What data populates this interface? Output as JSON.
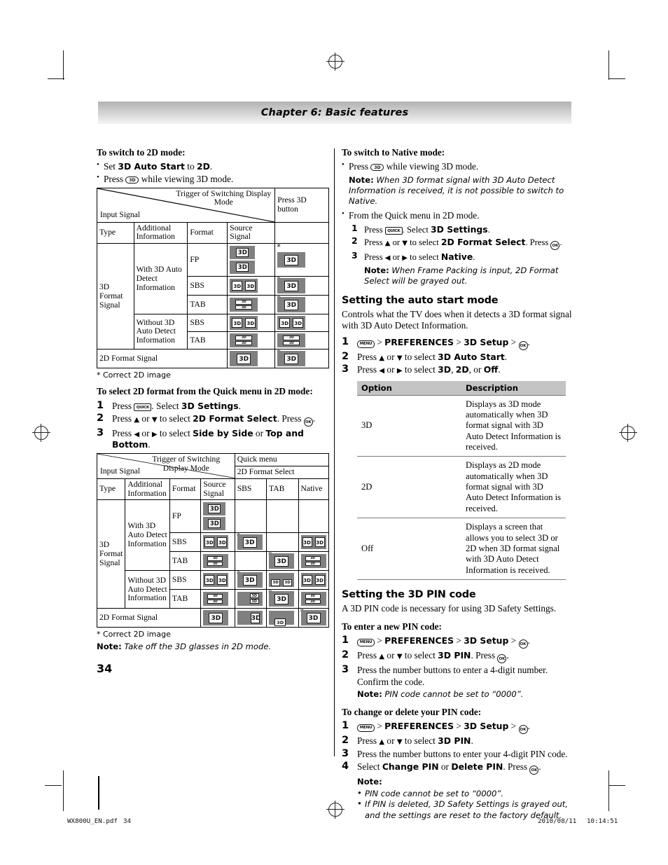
{
  "header": {
    "chapter_title": "Chapter 6: Basic features"
  },
  "left_column": {
    "switch_2d": {
      "heading": "To switch to 2D mode:",
      "bullets": [
        {
          "pre": "Set ",
          "bold1": "3D Auto Start",
          "mid": " to ",
          "bold2": "2D",
          "post": "."
        },
        {
          "pre": "Press ",
          "key": "3D",
          "post": " while viewing 3D mode."
        }
      ]
    },
    "table1": {
      "corner_trigger": "Trigger of Switching Display Mode",
      "corner_input": "Input Signal",
      "col_press3d": "Press 3D button",
      "subheaders": [
        "Type",
        "Additional Information",
        "Format",
        "Source Signal"
      ],
      "rows": [
        {
          "type": "3D Format Signal",
          "info": "With 3D Auto Detect Information",
          "format": "FP",
          "source": "fp",
          "press3d": "full",
          "press3d_star": true
        },
        {
          "type": "",
          "info": "",
          "format": "SBS",
          "source": "sbs",
          "press3d": "full",
          "press3d_star": true
        },
        {
          "type": "",
          "info": "",
          "format": "TAB",
          "source": "tab",
          "press3d": "full",
          "press3d_star": true
        },
        {
          "type": "",
          "info": "Without 3D Auto Detect Information",
          "format": "SBS",
          "source": "sbs",
          "press3d": "sbs",
          "press3d_star": false
        },
        {
          "type": "",
          "info": "",
          "format": "TAB",
          "source": "tab",
          "press3d": "tab",
          "press3d_star": false
        }
      ],
      "last_row_label": "2D Format Signal",
      "last_row_source": "full",
      "last_row_press3d": "full",
      "last_row_star": true,
      "footnote": "* Correct 2D image"
    },
    "select_2d_quick": {
      "heading": "To select 2D format from the Quick menu in 2D mode:",
      "steps": [
        {
          "num": "1",
          "parts": [
            "Press ",
            "KEY:QUICK",
            ". Select ",
            "B:3D Settings",
            "."
          ]
        },
        {
          "num": "2",
          "parts": [
            "Press ",
            "ARROW:up",
            " or ",
            "ARROW:down",
            " to select ",
            "B:2D Format Select",
            ". Press ",
            "KEY:OK",
            "."
          ]
        },
        {
          "num": "3",
          "parts": [
            " Press ",
            "ARROW:left",
            " or ",
            "ARROW:right",
            " to select ",
            "B:Side by Side",
            " or ",
            "B:Top and Bottom",
            "."
          ]
        }
      ]
    },
    "table2": {
      "corner_trigger": "Trigger of Switching Display Mode",
      "corner_input": "Input Signal",
      "col_quickmenu": "Quick menu",
      "col_2dformat": "2D Format Select",
      "subheaders": [
        "Type",
        "Additional Information",
        "Format",
        "Source Signal"
      ],
      "opt_headers": [
        "SBS",
        "TAB",
        "Native"
      ],
      "rows": [
        {
          "type": "3D Format Signal",
          "info": "With 3D Auto Detect Information",
          "format": "FP",
          "source": "fp",
          "sbs": {
            "icon": "gray"
          },
          "tab": {
            "icon": "gray"
          },
          "native": {
            "icon": "gray"
          }
        },
        {
          "type": "",
          "info": "",
          "format": "SBS",
          "source": "sbs",
          "sbs": {
            "icon": "full",
            "star": true
          },
          "tab": {
            "icon": "gray"
          },
          "native": {
            "icon": "sbs"
          }
        },
        {
          "type": "",
          "info": "",
          "format": "TAB",
          "source": "tab",
          "sbs": {
            "icon": "gray"
          },
          "tab": {
            "icon": "full",
            "star": true
          },
          "native": {
            "icon": "tab"
          }
        },
        {
          "type": "",
          "info": "Without 3D Auto Detect Information",
          "format": "SBS",
          "source": "sbs",
          "sbs": {
            "icon": "full",
            "star": true
          },
          "tab": {
            "icon": "sbs-sq"
          },
          "native": {
            "icon": "sbs"
          }
        },
        {
          "type": "",
          "info": "",
          "format": "TAB",
          "source": "tab",
          "sbs": {
            "icon": "tab-sq"
          },
          "tab": {
            "icon": "full",
            "star": true
          },
          "native": {
            "icon": "tab"
          }
        }
      ],
      "last_row_label": "2D Format Signal",
      "last_row_source": "full",
      "last_row_sbs": {
        "icon": "narrow"
      },
      "last_row_tab": {
        "icon": "small-bl"
      },
      "last_row_native": {
        "icon": "full",
        "star": true
      },
      "footnote": "* Correct 2D image",
      "note_label": "Note:",
      "note_text": " Take off the 3D glasses in 2D mode."
    },
    "page_number": "34"
  },
  "right_column": {
    "switch_native": {
      "heading": "To switch to Native mode:",
      "bullet1_pre": "Press ",
      "bullet1_post": " while viewing 3D mode.",
      "note1_label": "Note:",
      "note1_text": " When 3D format signal with 3D Auto Detect Information is received, it is not possible to switch to Native.",
      "bullet2": "From the Quick menu in 2D mode.",
      "steps": [
        {
          "num": "1",
          "parts": [
            "Press ",
            "KEY:QUICK",
            ". Select ",
            "B:3D Settings",
            "."
          ]
        },
        {
          "num": "2",
          "parts": [
            "Press ",
            "ARROW:up",
            " or ",
            "ARROW:down",
            " to select ",
            "B:2D Format Select",
            ". Press ",
            "KEY:OK",
            "."
          ]
        },
        {
          "num": "3",
          "parts": [
            " Press ",
            "ARROW:left",
            " or ",
            "ARROW:right",
            " to select ",
            "B:Native",
            "."
          ]
        }
      ],
      "note2_label": "Note:",
      "note2_text": " When Frame Packing is input, 2D Format Select will be grayed out."
    },
    "auto_start": {
      "heading": "Setting the auto start mode",
      "intro": "Controls what the TV does when it detects a 3D format signal with 3D Auto Detect Information.",
      "steps": [
        {
          "num": "1",
          "parts": [
            "KEY:MENU",
            " > ",
            "B:PREFERENCES",
            " > ",
            "B:3D Setup",
            " > ",
            "KEY:OK",
            "."
          ]
        },
        {
          "num": "2",
          "parts": [
            "Press ",
            "ARROW:up",
            " or ",
            "ARROW:down",
            " to select ",
            "B:3D Auto Start",
            "."
          ]
        },
        {
          "num": "3",
          "parts": [
            "Press ",
            "ARROW:left",
            " or ",
            "ARROW:right",
            " to select ",
            "B:3D",
            ", ",
            "B:2D",
            ", or ",
            "B:Off",
            "."
          ]
        }
      ],
      "table": {
        "headers": [
          "Option",
          "Description"
        ],
        "rows": [
          {
            "option": "3D",
            "description": "Displays as 3D mode automatically when 3D format signal with 3D Auto Detect Information is received."
          },
          {
            "option": "2D",
            "description": "Displays as 2D mode automatically when 3D format signal with 3D Auto Detect Information is received."
          },
          {
            "option": "Off",
            "description": "Displays a screen that allows you to select 3D or 2D when 3D format signal with 3D Auto Detect Information is received."
          }
        ]
      }
    },
    "pin_code": {
      "heading": "Setting the 3D PIN code",
      "intro": "A 3D PIN code is necessary for using 3D Safety Settings.",
      "enter_heading": "To enter a new PIN code:",
      "enter_steps": [
        {
          "num": "1",
          "parts": [
            "KEY:MENU",
            " > ",
            "B:PREFERENCES",
            " > ",
            "B:3D Setup",
            " > ",
            "KEY:OK",
            "."
          ]
        },
        {
          "num": "2",
          "parts": [
            "Press ",
            "ARROW:up",
            " or ",
            "ARROW:down",
            " to select ",
            "B:3D PIN",
            ". Press ",
            "KEY:OK",
            "."
          ]
        },
        {
          "num": "3",
          "parts": [
            "Press the number buttons to enter a 4-digit number. Confirm the code."
          ]
        }
      ],
      "enter_note_label": "Note:",
      "enter_note_text": " PIN code cannot be set to “0000”.",
      "change_heading": "To change or delete your PIN code:",
      "change_steps": [
        {
          "num": "1",
          "parts": [
            "KEY:MENU",
            " > ",
            "B:PREFERENCES",
            " > ",
            "B:3D Setup",
            " > ",
            "KEY:OK",
            "."
          ]
        },
        {
          "num": "2",
          "parts": [
            "Press ",
            "ARROW:up",
            " or ",
            "ARROW:down",
            " to select ",
            "B:3D PIN",
            "."
          ]
        },
        {
          "num": "3",
          "parts": [
            "Press the number buttons to enter your 4-digit PIN code."
          ]
        },
        {
          "num": "4",
          "parts": [
            "Select ",
            "B:Change PIN",
            " or ",
            "B:Delete PIN",
            ". Press ",
            "KEY:OK",
            "."
          ]
        }
      ],
      "change_note_label": "Note:",
      "change_notes": [
        "PIN code cannot be set to “0000”.",
        "If PIN is deleted, 3D Safety Settings is grayed out, and the settings are reset to the factory default."
      ]
    }
  },
  "keys": {
    "3d": "3D",
    "quick": "QUICK",
    "menu": "MENU",
    "ok": "OK"
  },
  "print_footer": {
    "filename": "WX800U_EN.pdf",
    "page": "34",
    "date": "2010/08/11",
    "time": "10:14:51"
  },
  "colors": {
    "gray_icon_bg": "#808080",
    "gray_disabled_cell": "#c0c0c0",
    "table_header_bg": "#c4c4c4",
    "banner_start": "#b2b2b2",
    "banner_end": "#f4f4f4"
  }
}
